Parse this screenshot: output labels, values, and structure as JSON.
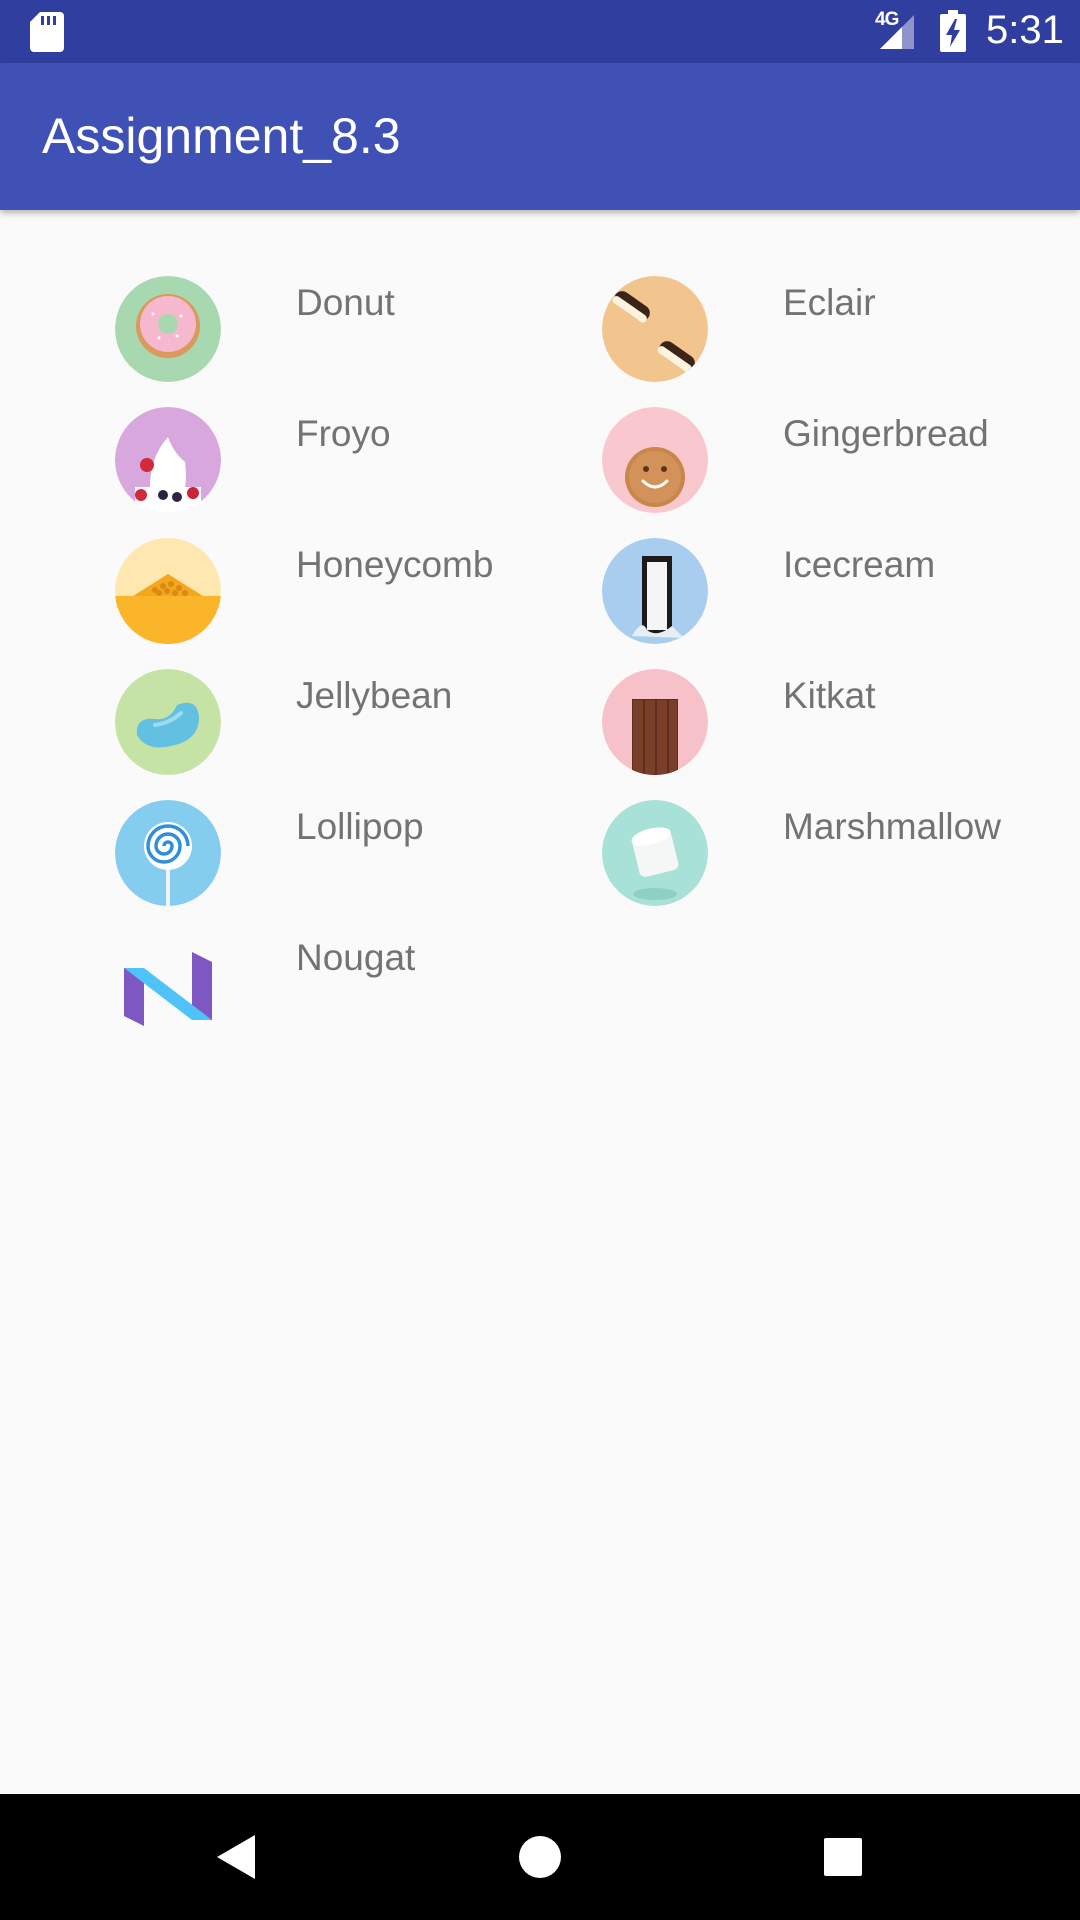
{
  "status_bar": {
    "network": "4G",
    "time": "5:31",
    "icons": [
      "sd-card-icon",
      "signal-icon",
      "battery-charging-icon"
    ]
  },
  "app_bar": {
    "title": "Assignment_8.3"
  },
  "items": [
    {
      "label": "Donut",
      "icon": "donut-icon"
    },
    {
      "label": "Eclair",
      "icon": "eclair-icon"
    },
    {
      "label": "Froyo",
      "icon": "froyo-icon"
    },
    {
      "label": "Gingerbread",
      "icon": "gingerbread-icon"
    },
    {
      "label": "Honeycomb",
      "icon": "honeycomb-icon"
    },
    {
      "label": "Icecream",
      "icon": "icecream-icon"
    },
    {
      "label": "Jellybean",
      "icon": "jellybean-icon"
    },
    {
      "label": "Kitkat",
      "icon": "kitkat-icon"
    },
    {
      "label": "Lollipop",
      "icon": "lollipop-icon"
    },
    {
      "label": "Marshmallow",
      "icon": "marshmallow-icon"
    },
    {
      "label": "Nougat",
      "icon": "nougat-icon"
    }
  ],
  "nav_bar": {
    "buttons": [
      "back-icon",
      "home-icon",
      "recents-icon"
    ]
  },
  "colors": {
    "status_bar": "#303f9f",
    "app_bar": "#3f51b5",
    "background": "#fafafa",
    "label_text": "#737373"
  }
}
